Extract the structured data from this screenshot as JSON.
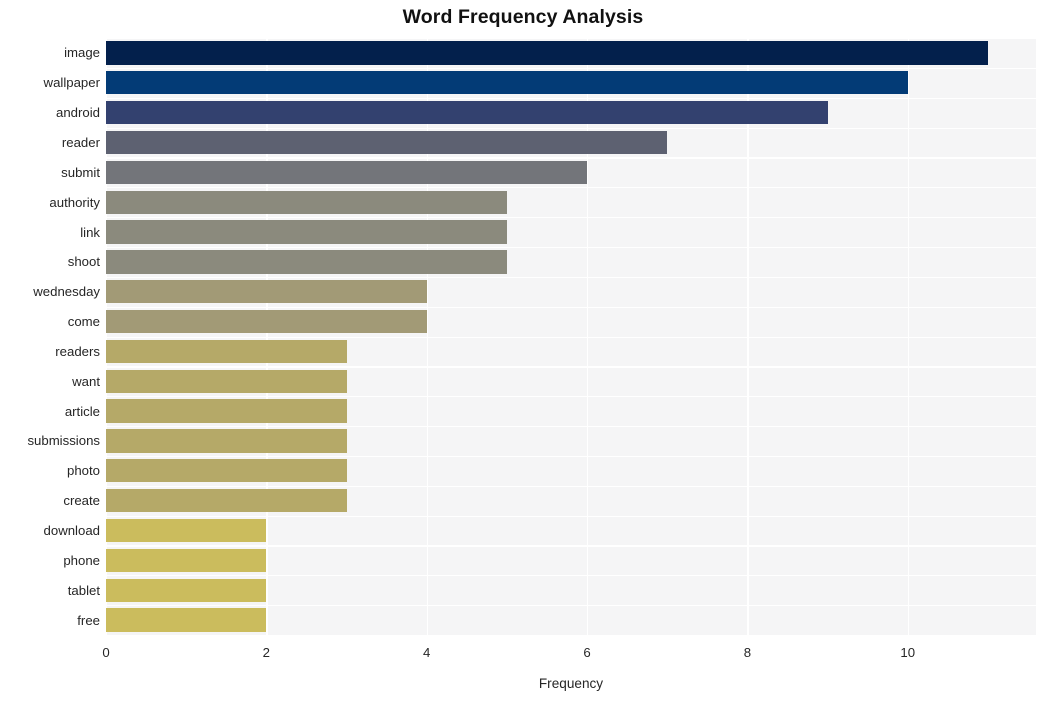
{
  "chart_data": {
    "type": "bar",
    "orientation": "horizontal",
    "title": "Word Frequency Analysis",
    "xlabel": "Frequency",
    "ylabel": "",
    "categories": [
      "image",
      "wallpaper",
      "android",
      "reader",
      "submit",
      "authority",
      "link",
      "shoot",
      "wednesday",
      "come",
      "readers",
      "want",
      "article",
      "submissions",
      "photo",
      "create",
      "download",
      "phone",
      "tablet",
      "free"
    ],
    "values": [
      11,
      10,
      9,
      7,
      6,
      5,
      5,
      5,
      4,
      4,
      3,
      3,
      3,
      3,
      3,
      3,
      2,
      2,
      2,
      2
    ],
    "bar_colors": [
      "#03204c",
      "#033b76",
      "#33416f",
      "#5d6171",
      "#73757a",
      "#8b8a7d",
      "#8b8a7d",
      "#8b8a7d",
      "#a29a76",
      "#a29a76",
      "#b5a968",
      "#b5a968",
      "#b5a968",
      "#b5a968",
      "#b5a968",
      "#b5a968",
      "#cbbc5d",
      "#cbbc5d",
      "#cbbc5d",
      "#cbbc5d"
    ],
    "xlim": [
      0,
      11.6
    ],
    "xticks": [
      0,
      2,
      4,
      6,
      8,
      10
    ],
    "xticklabels": [
      "0",
      "2",
      "4",
      "6",
      "8",
      "10"
    ],
    "grid": true,
    "grid_color": "#ffffff",
    "plot_background": "#f5f5f6",
    "figure_background": "#ffffff",
    "legend": null,
    "legend_position": "none"
  }
}
